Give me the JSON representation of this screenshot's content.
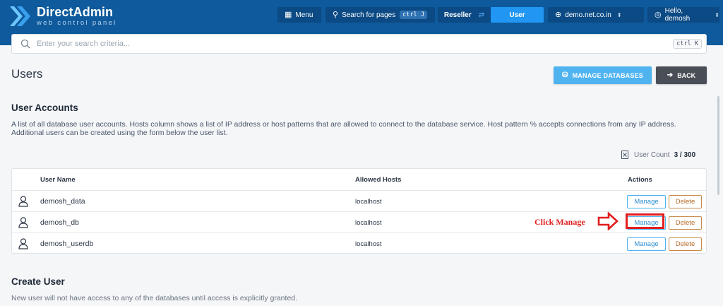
{
  "brand": {
    "title": "DirectAdmin",
    "subtitle": "web control panel"
  },
  "header": {
    "menu_label": "Menu",
    "search_label": "Search for pages",
    "search_shortcut": "ctrl J",
    "level_reseller": "Reseller",
    "level_user": "User",
    "domain": "demo.net.co.in",
    "greeting": "Hello, demosh"
  },
  "search": {
    "placeholder": "Enter your search criteria...",
    "shortcut": "ctrl K"
  },
  "page": {
    "title": "Users",
    "manage_databases_label": "MANAGE DATABASES",
    "back_label": "BACK"
  },
  "user_accounts": {
    "title": "User Accounts",
    "description": "A list of all database user accounts. Hosts column shows a list of IP address or host patterns that are allowed to connect to the database service. Host pattern % accepts connections from any IP address. Additional users can be created using the form below the user list.",
    "count_label": "User Count",
    "count_value": "3 / 300",
    "columns": {
      "name": "User Name",
      "hosts": "Allowed Hosts",
      "actions": "Actions"
    },
    "rows": [
      {
        "name": "demosh_data",
        "hosts": "localhost",
        "manage": "Manage",
        "delete": "Delete"
      },
      {
        "name": "demosh_db",
        "hosts": "localhost",
        "manage": "Manage",
        "delete": "Delete"
      },
      {
        "name": "demosh_userdb",
        "hosts": "localhost",
        "manage": "Manage",
        "delete": "Delete"
      }
    ]
  },
  "annotation": {
    "text": "Click Manage",
    "color": "#e11d1d"
  },
  "create_user": {
    "title": "Create User",
    "description": "New user will not have access to any of the databases until access is explicitly granted."
  },
  "colors": {
    "header": "#0e5a9c",
    "accent": "#2196f3",
    "manage_border": "#4fb3f0",
    "delete_border": "#c98a4b"
  }
}
